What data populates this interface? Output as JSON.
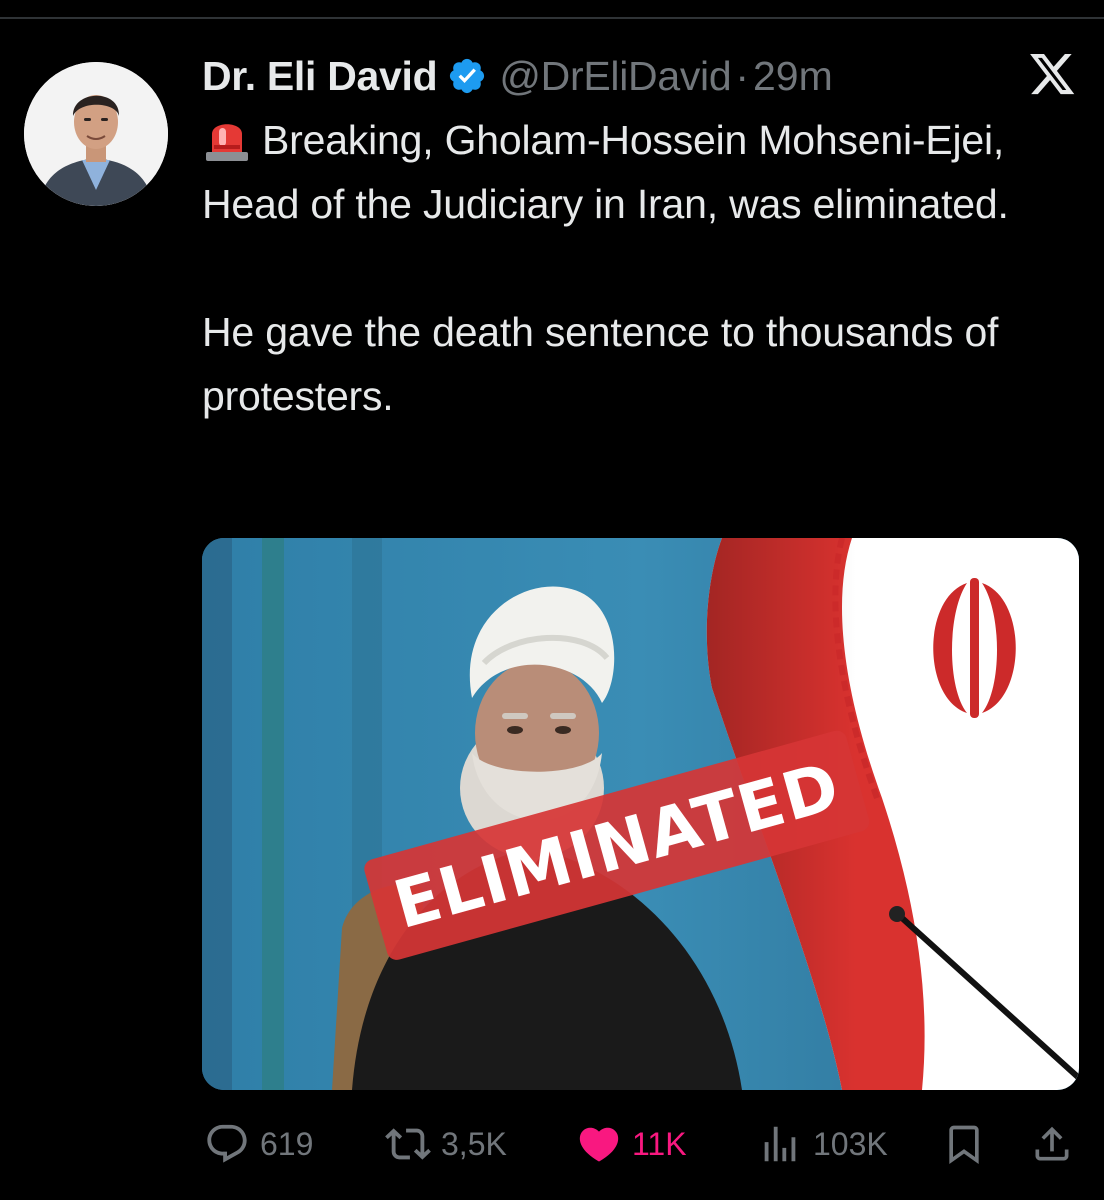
{
  "tweet": {
    "author": {
      "display_name": "Dr. Eli David",
      "handle": "@DrEliDavid",
      "separator": "·",
      "time": "29m",
      "verified": true
    },
    "text": {
      "emoji_icon": "rotating-light-siren",
      "line1": "Breaking, Gholam-Hossein Mohseni-Ejei, Head of the Judiciary in Iran, was eliminated.",
      "line2": "He gave the death sentence to thousands of protesters."
    },
    "media": {
      "stamp_text": "ELIMINATED"
    },
    "stats": {
      "replies": "619",
      "reposts": "3,5K",
      "likes": "11K",
      "views": "103K"
    }
  },
  "colors": {
    "background": "#000000",
    "text": "#e7e9ea",
    "secondary_text": "#71767b",
    "verified_blue": "#1d9bf0",
    "like_pink": "#f91880",
    "stamp_red": "#d63535"
  }
}
